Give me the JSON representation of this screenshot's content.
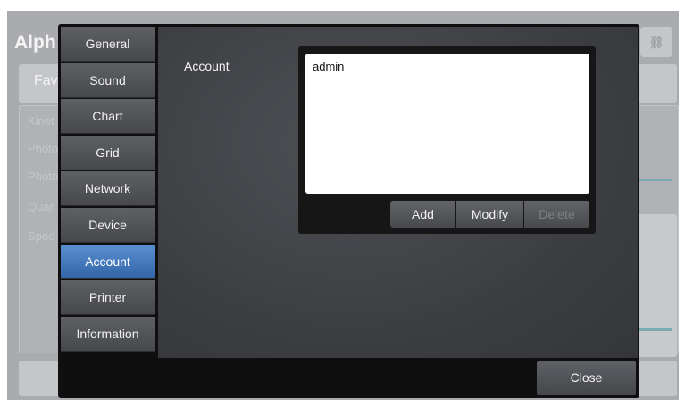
{
  "background_app": {
    "title": "Alph",
    "favorites_tab": "Fav",
    "list_items": [
      "Kinet",
      "Photo",
      "Photo",
      "Quar",
      "Spec"
    ],
    "corner_icon": "printer-icon"
  },
  "dialog": {
    "tabs": [
      {
        "label": "General",
        "active": false
      },
      {
        "label": "Sound",
        "active": false
      },
      {
        "label": "Chart",
        "active": false
      },
      {
        "label": "Grid",
        "active": false
      },
      {
        "label": "Network",
        "active": false
      },
      {
        "label": "Device",
        "active": false
      },
      {
        "label": "Account",
        "active": true
      },
      {
        "label": "Printer",
        "active": false
      },
      {
        "label": "Information",
        "active": false
      }
    ],
    "account": {
      "field_label": "Account",
      "accounts": [
        "admin"
      ],
      "add_label": "Add",
      "modify_label": "Modify",
      "delete_label": "Delete",
      "delete_enabled": false
    },
    "close_label": "Close"
  },
  "colors": {
    "active_tab": "#3f78c0",
    "dialog_background": "#0f0f10",
    "content_background": "#45474b"
  }
}
